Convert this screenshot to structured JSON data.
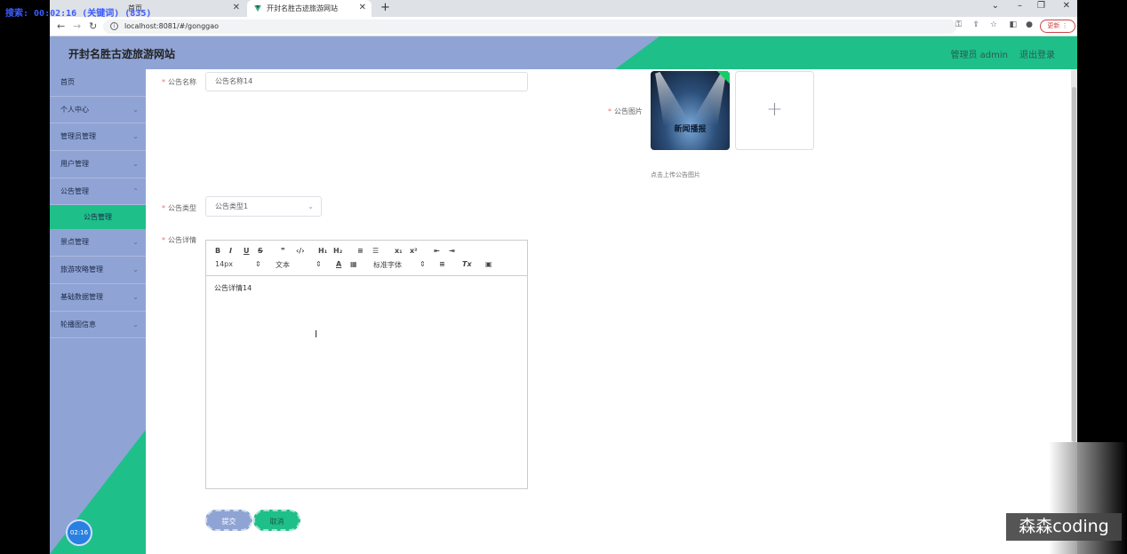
{
  "recording": {
    "text": "搜索: 00:02:16 (关键词) (835)"
  },
  "browser": {
    "tabs": [
      {
        "label": "首页"
      },
      {
        "label": "开封名胜古迹旅游网站"
      }
    ],
    "url": "localhost:8081/#/gonggao",
    "update_label": "更新"
  },
  "header": {
    "title": "开封名胜古迹旅游网站",
    "user": "管理员 admin",
    "logout": "退出登录"
  },
  "sidebar": {
    "items": [
      {
        "label": "首页"
      },
      {
        "label": "个人中心"
      },
      {
        "label": "管理员管理"
      },
      {
        "label": "用户管理"
      },
      {
        "label": "公告管理"
      },
      {
        "label": "景点管理"
      },
      {
        "label": "旅游攻略管理"
      },
      {
        "label": "基础数据管理"
      },
      {
        "label": "轮播图信息"
      }
    ],
    "sub_item": "公告管理",
    "timer": "02:16"
  },
  "form": {
    "name_label": "公告名称",
    "name_value": "公告名称14",
    "image_label": "公告图片",
    "image_caption": "新闻播报",
    "upload_tip": "点击上传公告图片",
    "type_label": "公告类型",
    "type_value": "公告类型1",
    "detail_label": "公告详情",
    "detail_value": "公告详情14",
    "submit": "提交",
    "cancel": "取消"
  },
  "editor": {
    "font_size": "14px",
    "text_style": "文本",
    "font_family": "标准字体"
  },
  "watermark": "森森coding"
}
